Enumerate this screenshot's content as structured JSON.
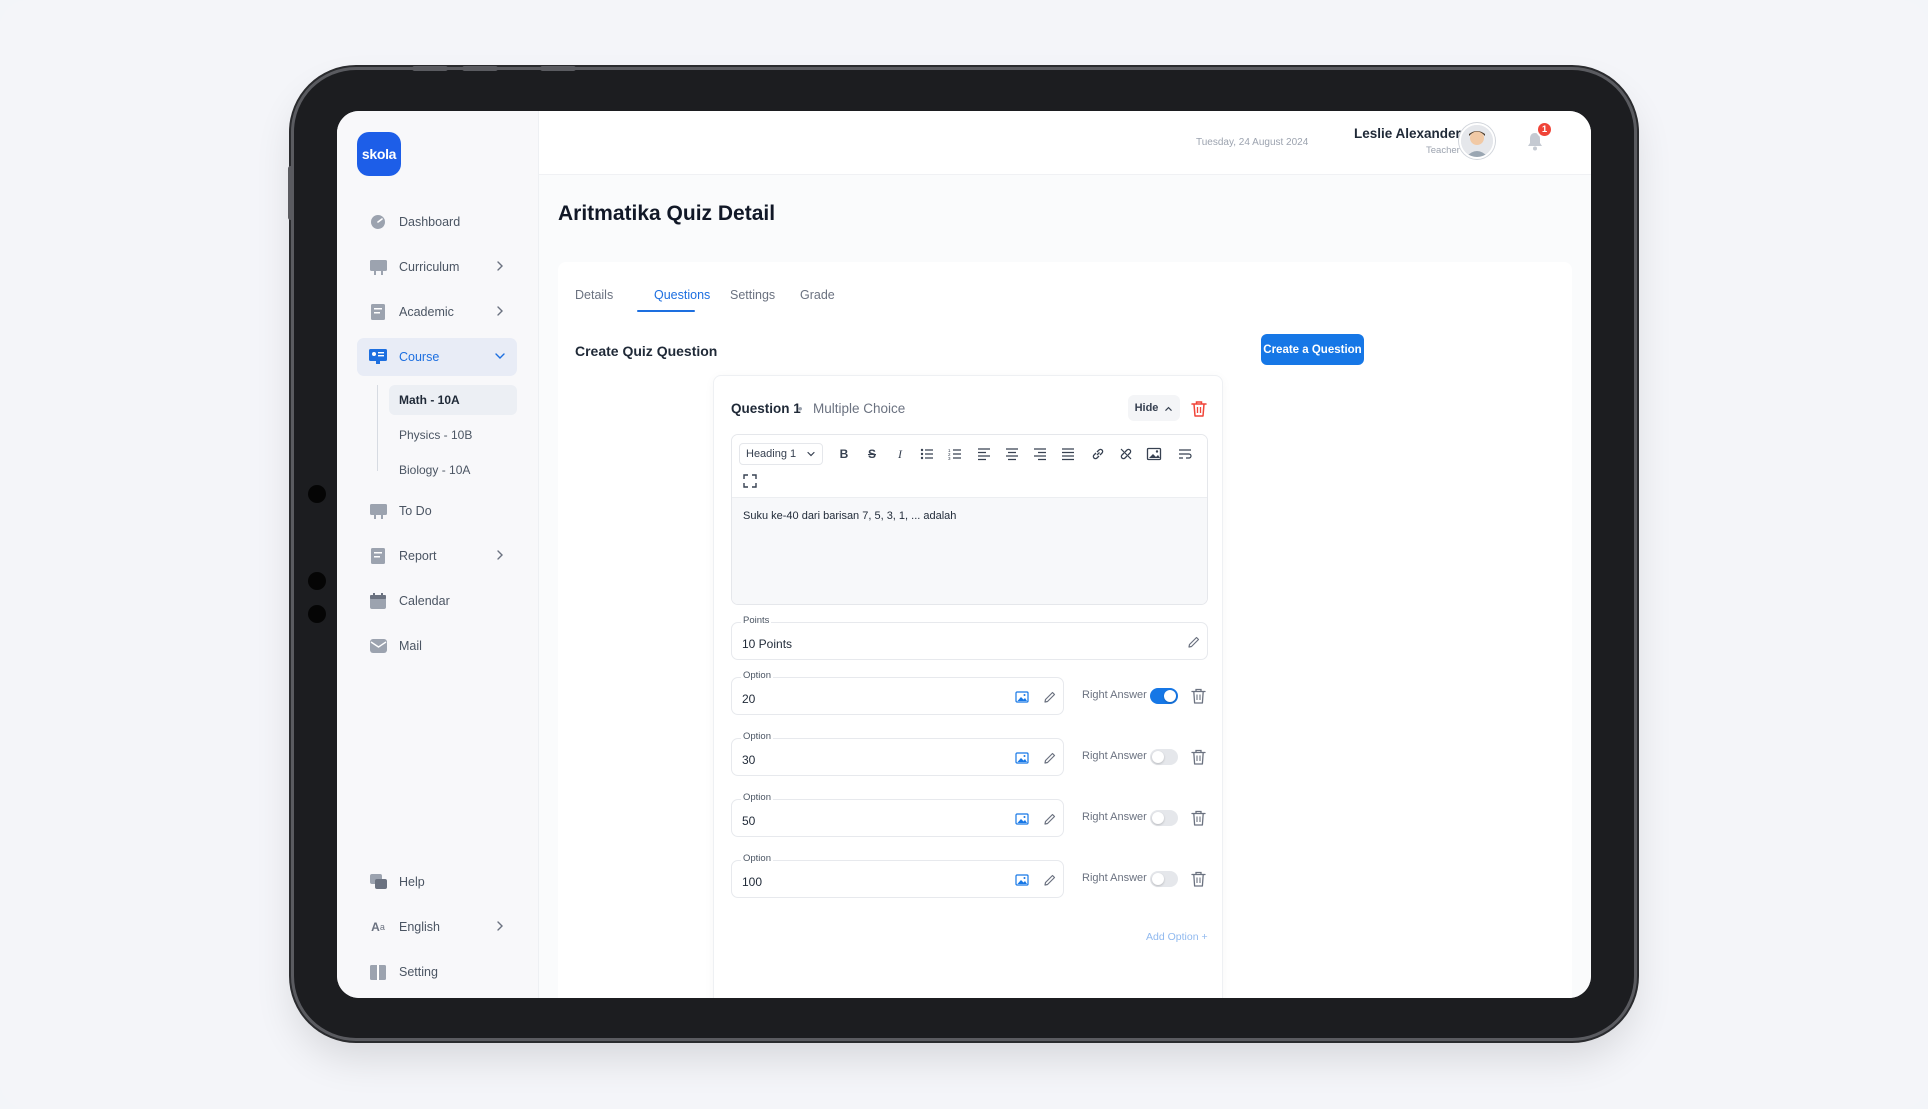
{
  "app": {
    "logo_text": "skola",
    "date": "Tuesday, 24 August 2024"
  },
  "user": {
    "name": "Leslie Alexander",
    "role": "Teacher",
    "notifications": "1"
  },
  "sidebar": {
    "items": [
      {
        "label": "Dashboard",
        "icon": "dashboard-icon"
      },
      {
        "label": "Curriculum",
        "icon": "curriculum-icon",
        "has_chevron": true
      },
      {
        "label": "Academic",
        "icon": "academic-icon",
        "has_chevron": true
      },
      {
        "label": "Course",
        "icon": "course-icon",
        "has_chevron": true,
        "active": true
      },
      {
        "label": "To Do",
        "icon": "todo-icon"
      },
      {
        "label": "Report",
        "icon": "report-icon",
        "has_chevron": true
      },
      {
        "label": "Calendar",
        "icon": "calendar-icon"
      },
      {
        "label": "Mail",
        "icon": "mail-icon"
      }
    ],
    "course_sub": [
      "Math - 10A",
      "Physics - 10B",
      "Biology - 10A"
    ],
    "bottom": [
      {
        "label": "Help",
        "icon": "help-icon"
      },
      {
        "label": "English",
        "icon": "language-icon",
        "has_chevron": true
      },
      {
        "label": "Setting",
        "icon": "setting-icon"
      }
    ]
  },
  "page": {
    "title": "Aritmatika Quiz Detail",
    "tabs": [
      "Details",
      "Questions",
      "Settings",
      "Grade"
    ],
    "active_tab": "Questions",
    "section_title": "Create Quiz Question",
    "create_button": "Create a Question"
  },
  "question": {
    "title": "Question 1",
    "separator": "•",
    "type": "Multiple Choice",
    "hide_label": "Hide",
    "editor": {
      "heading_select": "Heading 1",
      "text": "Suku ke-40 dari barisan 7, 5, 3, 1, ... adalah"
    },
    "points": {
      "label": "Points",
      "value": "10 Points"
    },
    "options": [
      {
        "label": "Option",
        "value": "20",
        "right_answer_label": "Right Answer",
        "right_answer": true
      },
      {
        "label": "Option",
        "value": "30",
        "right_answer_label": "Right Answer",
        "right_answer": false
      },
      {
        "label": "Option",
        "value": "50",
        "right_answer_label": "Right Answer",
        "right_answer": false
      },
      {
        "label": "Option",
        "value": "100",
        "right_answer_label": "Right Answer",
        "right_answer": false
      }
    ],
    "add_option_label": "Add Option +"
  },
  "colors": {
    "primary": "#1677e6",
    "brand": "#1d5ee8",
    "danger": "#f04438"
  }
}
